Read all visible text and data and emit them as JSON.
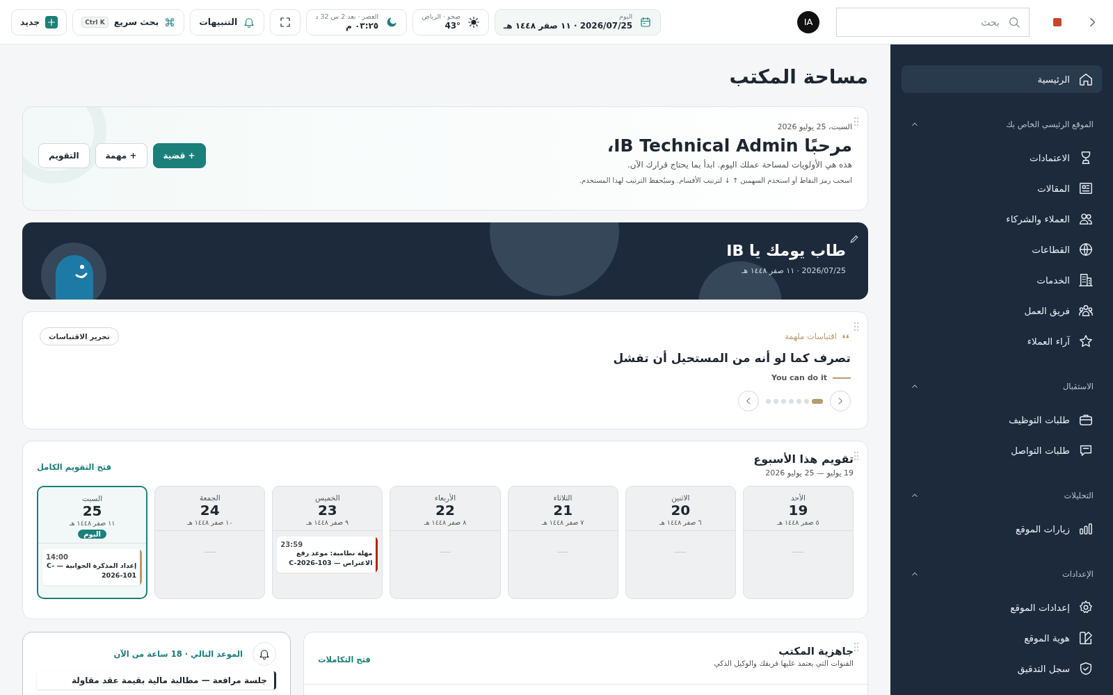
{
  "topbar": {
    "search": {
      "placeholder": "بحث"
    },
    "avatar": "IA",
    "date_chip": {
      "label": "اليوم",
      "value": "2026/07/25 · ١١ صفر ١٤٤٨ هـ"
    },
    "weather": {
      "label": "صحو · الرياض",
      "value": "43°"
    },
    "prayer": {
      "label": "العصر · بعد 2 س 32 د",
      "value": "٠٣:٢٥ م"
    },
    "notifications": "التنبيهات",
    "quick_search": {
      "label": "بحث سريع",
      "shortcut": "Ctrl K"
    },
    "new_button": "جديد"
  },
  "sidebar": {
    "items": [
      {
        "label": "الرئيسية",
        "selected": true
      }
    ],
    "sections": [
      {
        "title": "الموقع الرئيسي الخاص بك",
        "expanded": true,
        "items": [
          {
            "label": "الاعتمادات",
            "selected": false
          },
          {
            "label": "المقالات",
            "selected": false
          },
          {
            "label": "العملاء والشركاء",
            "selected": false
          },
          {
            "label": "القطاعات",
            "selected": false
          },
          {
            "label": "الخدمات",
            "selected": false
          },
          {
            "label": "فريق العمل",
            "selected": false
          },
          {
            "label": "آراء العملاء",
            "selected": false
          }
        ]
      },
      {
        "title": "الاستقبال",
        "expanded": true,
        "items": [
          {
            "label": "طلبات التوظيف",
            "selected": false
          },
          {
            "label": "طلبات التواصل",
            "selected": false
          }
        ]
      },
      {
        "title": "التحليلات",
        "expanded": true,
        "items": [
          {
            "label": "زيارات الموقع",
            "selected": false
          }
        ]
      },
      {
        "title": "الإعدادات",
        "expanded": true,
        "items": [
          {
            "label": "إعدادات الموقع",
            "selected": false
          },
          {
            "label": "هوية الموقع",
            "selected": false
          },
          {
            "label": "سجل التدقيق",
            "selected": false
          }
        ]
      }
    ]
  },
  "page_title": "مساحة المكتب",
  "hero": {
    "date": "السبت، 25 يوليو 2026",
    "title": "مرحبًا IB Technical Admin،",
    "subtitle": "هذه هي الأولويات لمساحة عملك اليوم. ابدأ بما يحتاج قرارك الآن.",
    "hint": "اسحب رمز النقاط أو استخدم السهمين ↑ ↓ لترتيب الأقسام. وسيُحفظ الترتيب لهذا المستخدم.",
    "buttons": [
      {
        "label": "+ قضية",
        "kind": "primary"
      },
      {
        "label": "+ مهمة",
        "kind": "secondary"
      },
      {
        "label": "التقويم",
        "kind": "secondary"
      }
    ]
  },
  "banner": {
    "title": "طاب يومك يا IB",
    "date": "2026/07/25 · ١١ صفر ١٤٤٨ هـ"
  },
  "quote": {
    "label": "اقتباسات ملهمة",
    "edit_button": "تحرير الاقتباسات",
    "text": "تصرف كما لو أنه من المستحيل أن تفشل",
    "author": "You can do it",
    "dots": [
      {
        "selected": true
      },
      {
        "selected": false
      },
      {
        "selected": false
      },
      {
        "selected": false
      },
      {
        "selected": false
      },
      {
        "selected": false
      },
      {
        "selected": false
      }
    ]
  },
  "calendar": {
    "title": "تقويم هذا الأسبوع",
    "range": "19 يوليو — 25 يوليو 2026",
    "link": "فتح التقويم الكامل",
    "today_badge": "اليوم",
    "days": [
      {
        "name": "الأحد",
        "number": "19",
        "hijri": "٥ صفر ١٤٤٨ هـ",
        "today": false
      },
      {
        "name": "الاثنين",
        "number": "20",
        "hijri": "٦ صفر ١٤٤٨ هـ",
        "today": false
      },
      {
        "name": "الثلاثاء",
        "number": "21",
        "hijri": "٧ صفر ١٤٤٨ هـ",
        "today": false
      },
      {
        "name": "الأربعاء",
        "number": "22",
        "hijri": "٨ صفر ١٤٤٨ هـ",
        "today": false
      },
      {
        "name": "الخميس",
        "number": "23",
        "hijri": "٩ صفر ١٤٤٨ هـ",
        "today": false,
        "events": [
          {
            "time": "23:59",
            "title": "مهلة نظامية: موعد رفع الاعتراض — C-2026-103",
            "color": "#b42318"
          }
        ]
      },
      {
        "name": "الجمعة",
        "number": "24",
        "hijri": "١٠ صفر ١٤٤٨ هـ",
        "today": false
      },
      {
        "name": "السبت",
        "number": "25",
        "hijri": "١١ صفر ١٤٤٨ هـ",
        "today": true,
        "events": [
          {
            "time": "14:00",
            "title": "إعداد المذكرة الجوابية — C-2026-101",
            "color": "#b89a6a"
          }
        ]
      }
    ]
  },
  "readiness": {
    "title": "جاهزية المكتب",
    "subtitle": "القنوات التي يعتمد عليها فريقك والوكيل الذكي",
    "link": "فتح التكاملات"
  },
  "next_appointment": {
    "title": "الموعد التالي · 18 ساعة من الآن",
    "item": "جلسة مرافعة — مطالبة مالية بقيمة عقد مقاولة"
  }
}
